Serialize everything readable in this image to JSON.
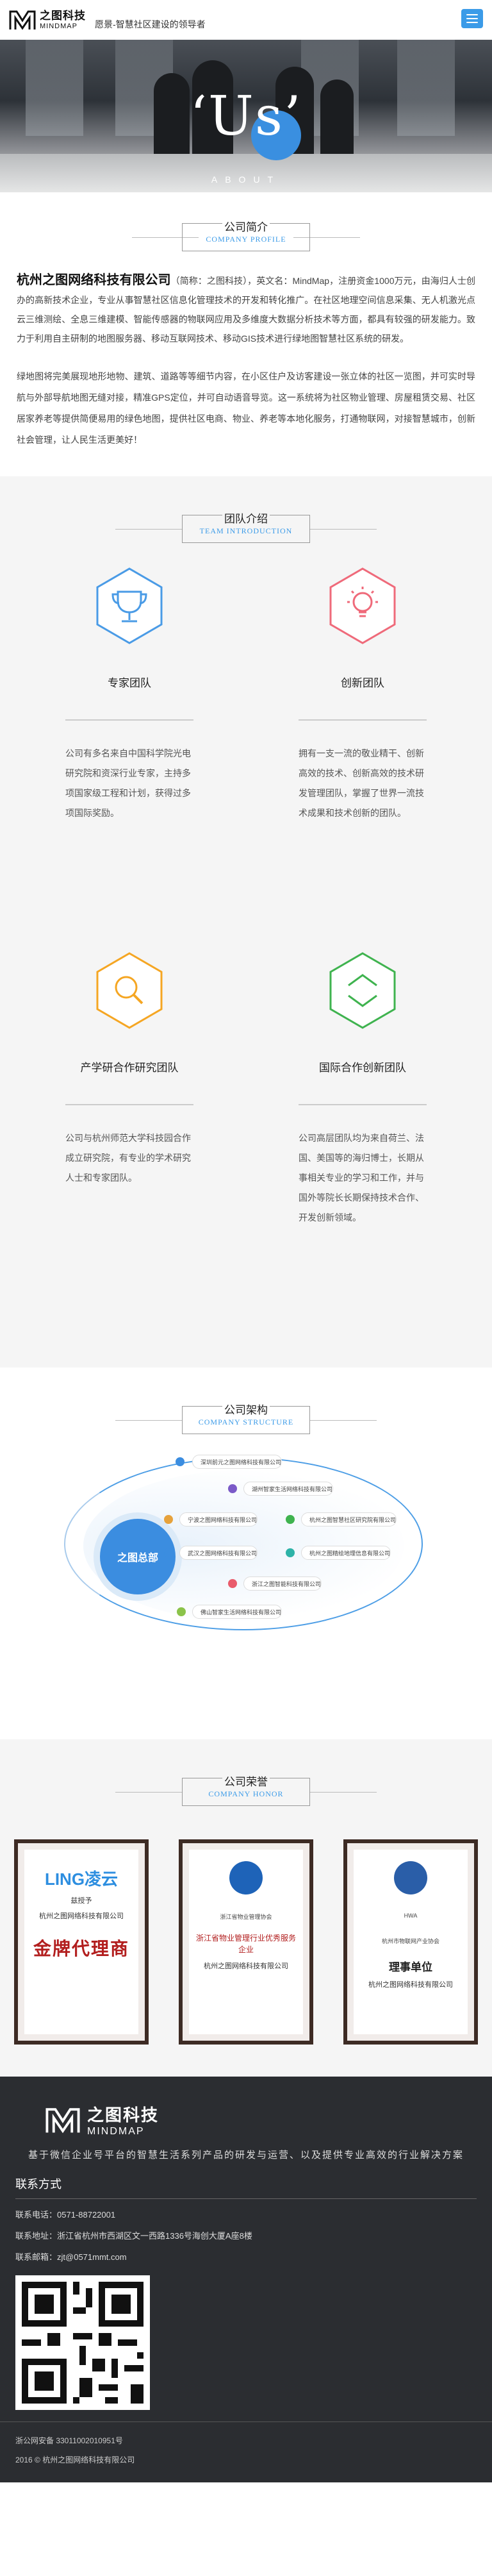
{
  "header": {
    "logo_cn": "之图科技",
    "logo_en": "MINDMAP",
    "slogan": "愿景-智慧社区建设的领导者"
  },
  "banner": {
    "title": "‘Us’",
    "subtitle": "ABOUT"
  },
  "intro": {
    "title_cn": "公司简介",
    "title_en": "COMPANY PROFILE",
    "company": "杭州之图网络科技有限公司",
    "para1": "（简称：之图科技），英文名：MindMap，注册资金1000万元，由海归人士创办的高新技术企业，专业从事智慧社区信息化管理技术的开发和转化推广。在社区地理空间信息采集、无人机激光点云三维测绘、全息三维建模、智能传感器的物联网应用及多维度大数据分析技术等方面，都具有较强的研发能力。致力于利用自主研制的地图服务器、移动互联网技术、移动GIS技术进行绿地图智慧社区系统的研发。",
    "para2": "绿地图将完美展现地形地物、建筑、道路等等细节内容，在小区住户及访客建设一张立体的社区一览图，并可实时导航与外部导航地图无缝对接，精准GPS定位，并可自动语音导览。这一系统将为社区物业管理、房屋租赁交易、社区居家养老等提供简便易用的绿色地图，提供社区电商、物业、养老等本地化服务，打通物联网，对接智慧城市，创新社会管理，让人民生活更美好！"
  },
  "team": {
    "title_cn": "团队介绍",
    "title_en": "TEAM INTRODUCTION",
    "items": [
      {
        "name": "专家团队",
        "icon": "trophy-icon",
        "desc": "公司有多名来自中国科学院光电研究院和资深行业专家，主持多项国家级工程和计划，获得过多项国际奖励。"
      },
      {
        "name": "创新团队",
        "icon": "lightbulb-icon",
        "desc": "拥有一支一流的敬业精干、创新高效的技术、创新高效的技术研发管理团队，掌握了世界一流技术成果和技术创新的团队。"
      },
      {
        "name": "产学研合作研究团队",
        "icon": "magnifier-icon",
        "desc": "公司与杭州师范大学科技园合作成立研究院，有专业的学术研究人士和专家团队。"
      },
      {
        "name": "国际合作创新团队",
        "icon": "exchange-icon",
        "desc": "公司高层团队均为来自荷兰、法国、美国等的海归博士，长期从事相关专业的学习和工作，并与国外等院长长期保持技术合作、开发创新领域。"
      }
    ],
    "colors": {
      "blue": "#4a9be6",
      "pink": "#ef6a7a",
      "orange": "#f5a623",
      "green": "#3fb34f"
    }
  },
  "structure": {
    "title_cn": "公司架构",
    "title_en": "COMPANY STRUCTURE",
    "center": "之图总部",
    "nodes": [
      "深圳前元之图网络科技有限公司",
      "湖州智家生活网络科技有限公司",
      "宁波之图网络科技有限公司",
      "杭州之图智慧社区研究院有限公司",
      "武汉之图网络科技有限公司",
      "杭州之图精绘地理信息有限公司",
      "浙江之图智能科技有限公司",
      "佛山智家生活网络科技有限公司"
    ]
  },
  "honor": {
    "title_cn": "公司荣誉",
    "title_en": "COMPANY HONOR",
    "certs": [
      {
        "brand": "LING凌云",
        "line1": "兹授予",
        "line2": "杭州之图网络科技有限公司",
        "main": "金牌代理商"
      },
      {
        "brand": "浙江省物业管理协会",
        "main": "浙江省物业管理行业优秀服务企业",
        "line2": "杭州之图网络科技有限公司"
      },
      {
        "brand": "HWA",
        "line1": "杭州市物联网产业协会",
        "main": "理事单位",
        "line2": "杭州之图网络科技有限公司"
      }
    ]
  },
  "footer": {
    "logo_cn": "之图科技",
    "logo_en": "MINDMAP",
    "slogan": "基于微信企业号平台的智慧生活系列产品的研发与运营、以及提供专业高效的行业解决方案",
    "contact_title": "联系方式",
    "phone_label": "联系电话：",
    "phone": "0571-88722001",
    "addr_label": "联系地址：",
    "addr": "浙江省杭州市西湖区文一西路1336号海创大厦A座8楼",
    "email_label": "联系邮箱：",
    "email": "zjt@0571mmt.com",
    "beian": "浙公网安备 33011002010951号",
    "copyright": "2016 © 杭州之图网络科技有限公司"
  }
}
